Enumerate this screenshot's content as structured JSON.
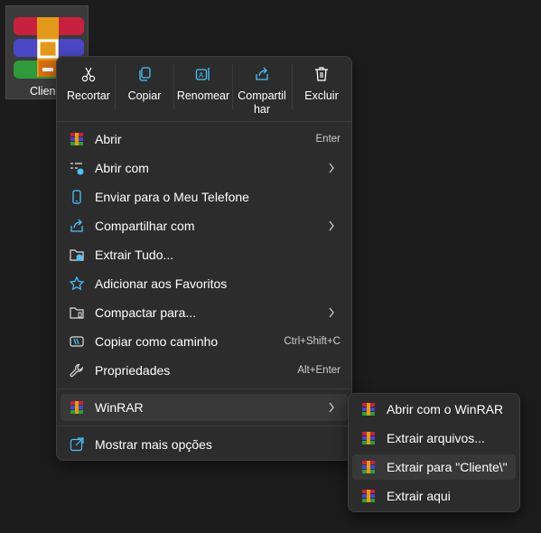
{
  "desktop": {
    "icon_label": "Clien"
  },
  "toolbar": {
    "cut": "Recortar",
    "copy": "Copiar",
    "rename": "Renomear",
    "share_line1": "Compartil",
    "share_line2": "har",
    "delete": "Excluir"
  },
  "menu": {
    "open": "Abrir",
    "open_shortcut": "Enter",
    "open_with": "Abrir com",
    "send_phone": "Enviar para o Meu Telefone",
    "share_with": "Compartilhar com",
    "extract_all": "Extrair Tudo...",
    "add_favorites": "Adicionar aos Favoritos",
    "compress": "Compactar para...",
    "copy_path": "Copiar como caminho",
    "copy_path_shortcut": "Ctrl+Shift+C",
    "properties": "Propriedades",
    "properties_shortcut": "Alt+Enter",
    "winrar": "WinRAR",
    "more_options": "Mostrar mais opções"
  },
  "submenu": {
    "open_winrar": "Abrir com o WinRAR",
    "extract_files": "Extrair arquivos...",
    "extract_to": "Extrair para \"Cliente\\\"",
    "extract_here": "Extrair aqui"
  },
  "colors": {
    "accent": "#4cc2ff",
    "menu_bg": "#2c2c2c",
    "hover_bg": "#383838"
  }
}
